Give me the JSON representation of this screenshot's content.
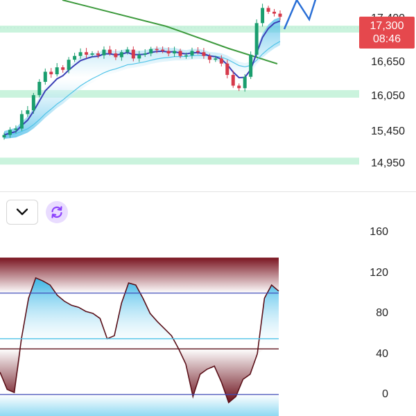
{
  "price_axis": {
    "labels": [
      "17,400",
      "16,650",
      "16,050",
      "15,450",
      "14,950"
    ]
  },
  "current_price": {
    "price": "17,300",
    "countdown": "08:46",
    "color": "#e5484d"
  },
  "oscillator_axis": {
    "labels": [
      "160",
      "120",
      "80",
      "40",
      "0"
    ]
  },
  "toolbar": {
    "collapse_icon": "chevron-down-icon",
    "refresh_icon": "refresh-icon",
    "refresh_color": "#8a3ffc"
  },
  "colors": {
    "bull": "#1a9e6e",
    "bear": "#d6394b",
    "zone": "#b8efd2",
    "long_ma": "#3d9a3d",
    "fast_ma": "#3b3fb6",
    "forecast": "#2a6fd6",
    "osc_line": "#3f4bb8",
    "osc_fill": "#3bb8e8",
    "osc_low": "#6b0f1a"
  },
  "chart_data": [
    {
      "type": "candlestick",
      "title": "",
      "ylim": [
        14800,
        17500
      ],
      "y_ticks": [
        17400,
        16650,
        16050,
        15450,
        14950
      ],
      "series": [
        {
          "values": [
            15430,
            15510,
            15530,
            15760,
            15820,
            16060,
            16270,
            16430,
            16390,
            16500,
            16460,
            16620,
            16680,
            16740,
            16700,
            16720,
            16690,
            16780,
            16720,
            16660,
            16740,
            16780,
            16640,
            16700,
            16720,
            16790,
            16780,
            16760,
            16720,
            16760,
            16680,
            16690,
            16760,
            16740,
            16680,
            16620,
            16640,
            16560,
            16380,
            16210,
            16170,
            16350,
            16700,
            17200,
            17440,
            17380,
            17350,
            17300
          ]
        }
      ],
      "support_zones": [
        [
          17120,
          17160
        ],
        [
          16020,
          16140
        ],
        [
          14990,
          15070
        ]
      ],
      "current_price": 17300
    },
    {
      "type": "area",
      "title": "",
      "ylim": [
        0,
        160
      ],
      "y_ticks": [
        160,
        120,
        80,
        40,
        0
      ],
      "levels": [
        120,
        100,
        55,
        45,
        0
      ],
      "series": [
        {
          "values": [
            22,
            5,
            2,
            55,
            95,
            115,
            112,
            108,
            98,
            92,
            88,
            86,
            82,
            80,
            75,
            55,
            58,
            90,
            110,
            108,
            95,
            80,
            72,
            65,
            58,
            45,
            30,
            -2,
            20,
            25,
            28,
            12,
            -8,
            -2,
            15,
            20,
            40,
            95,
            108,
            102
          ]
        }
      ]
    }
  ]
}
